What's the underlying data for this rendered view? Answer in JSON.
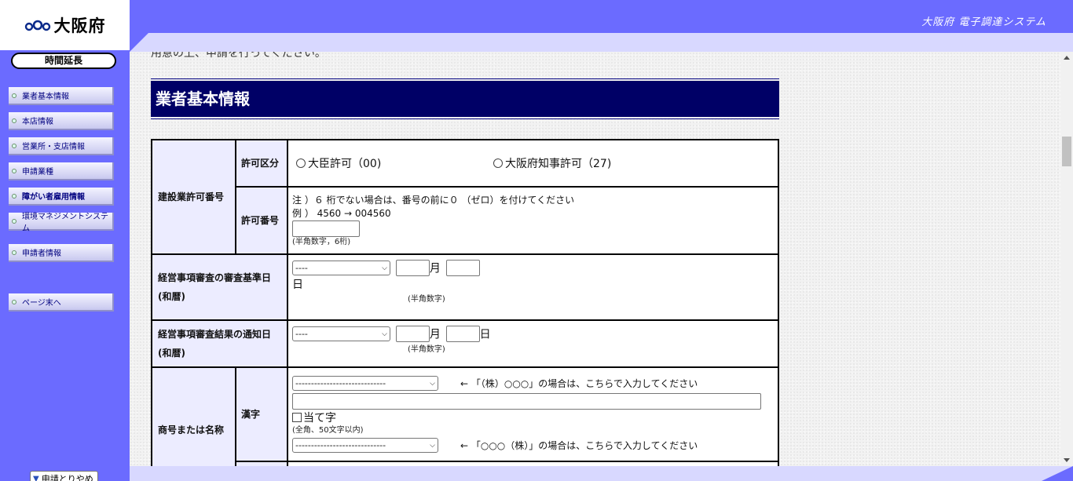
{
  "logo": {
    "name": "大阪府"
  },
  "header": {
    "system_name": "大阪府 電子調達システム"
  },
  "sidebar": {
    "extend_button": "時間延長",
    "items": [
      {
        "label": "業者基本情報",
        "bold": false
      },
      {
        "label": "本店情報",
        "bold": false
      },
      {
        "label": "営業所・支店情報",
        "bold": false
      },
      {
        "label": "申請業種",
        "bold": false
      },
      {
        "label": "障がい者雇用情報",
        "bold": true
      },
      {
        "label": "環境マネジメントシステム",
        "bold": false
      },
      {
        "label": "申請者情報",
        "bold": false
      },
      {
        "label": "ページ末へ",
        "bold": false
      }
    ],
    "quit_button": "申請とりやめ"
  },
  "main": {
    "cut_text": "用意の上、申請を行ってください。",
    "section_title": "業者基本情報",
    "form": {
      "construction_permit": {
        "label": "建設業許可番号",
        "permit_type": {
          "label": "許可区分",
          "options": [
            "大臣許可（00)",
            "大阪府知事許可（27)"
          ]
        },
        "permit_number": {
          "label": "許可番号",
          "note1": "注 ）６ 桁でない場合は、番号の前に０ （ゼロ）を付けてください",
          "note2": "例 ） 4560 → 004560",
          "hint": "(半角数字，6桁)"
        }
      },
      "review_base_date": {
        "label": "経営事項審査の審査基準日(和暦)",
        "era_value": "----",
        "month_unit": "月",
        "day_unit": "日",
        "hint": "(半角数字)"
      },
      "review_notice_date": {
        "label": "経営事項審査結果の通知日(和暦)",
        "era_value": "----",
        "month_unit": "月",
        "day_unit": "日",
        "hint": "(半角数字)"
      },
      "trade_name": {
        "label": "商号または名称",
        "kanji_label": "漢字",
        "prefix_select_value": "-----------------------------",
        "prefix_note": "← 「（株）○○○」の場合は、こちらで入力してください",
        "ateji_label": "当て字",
        "hint": "(全角、50文字以内)",
        "suffix_select_value": "-----------------------------",
        "suffix_note": "← 「○○○（株）」の場合は、こちらで入力してください"
      }
    }
  }
}
